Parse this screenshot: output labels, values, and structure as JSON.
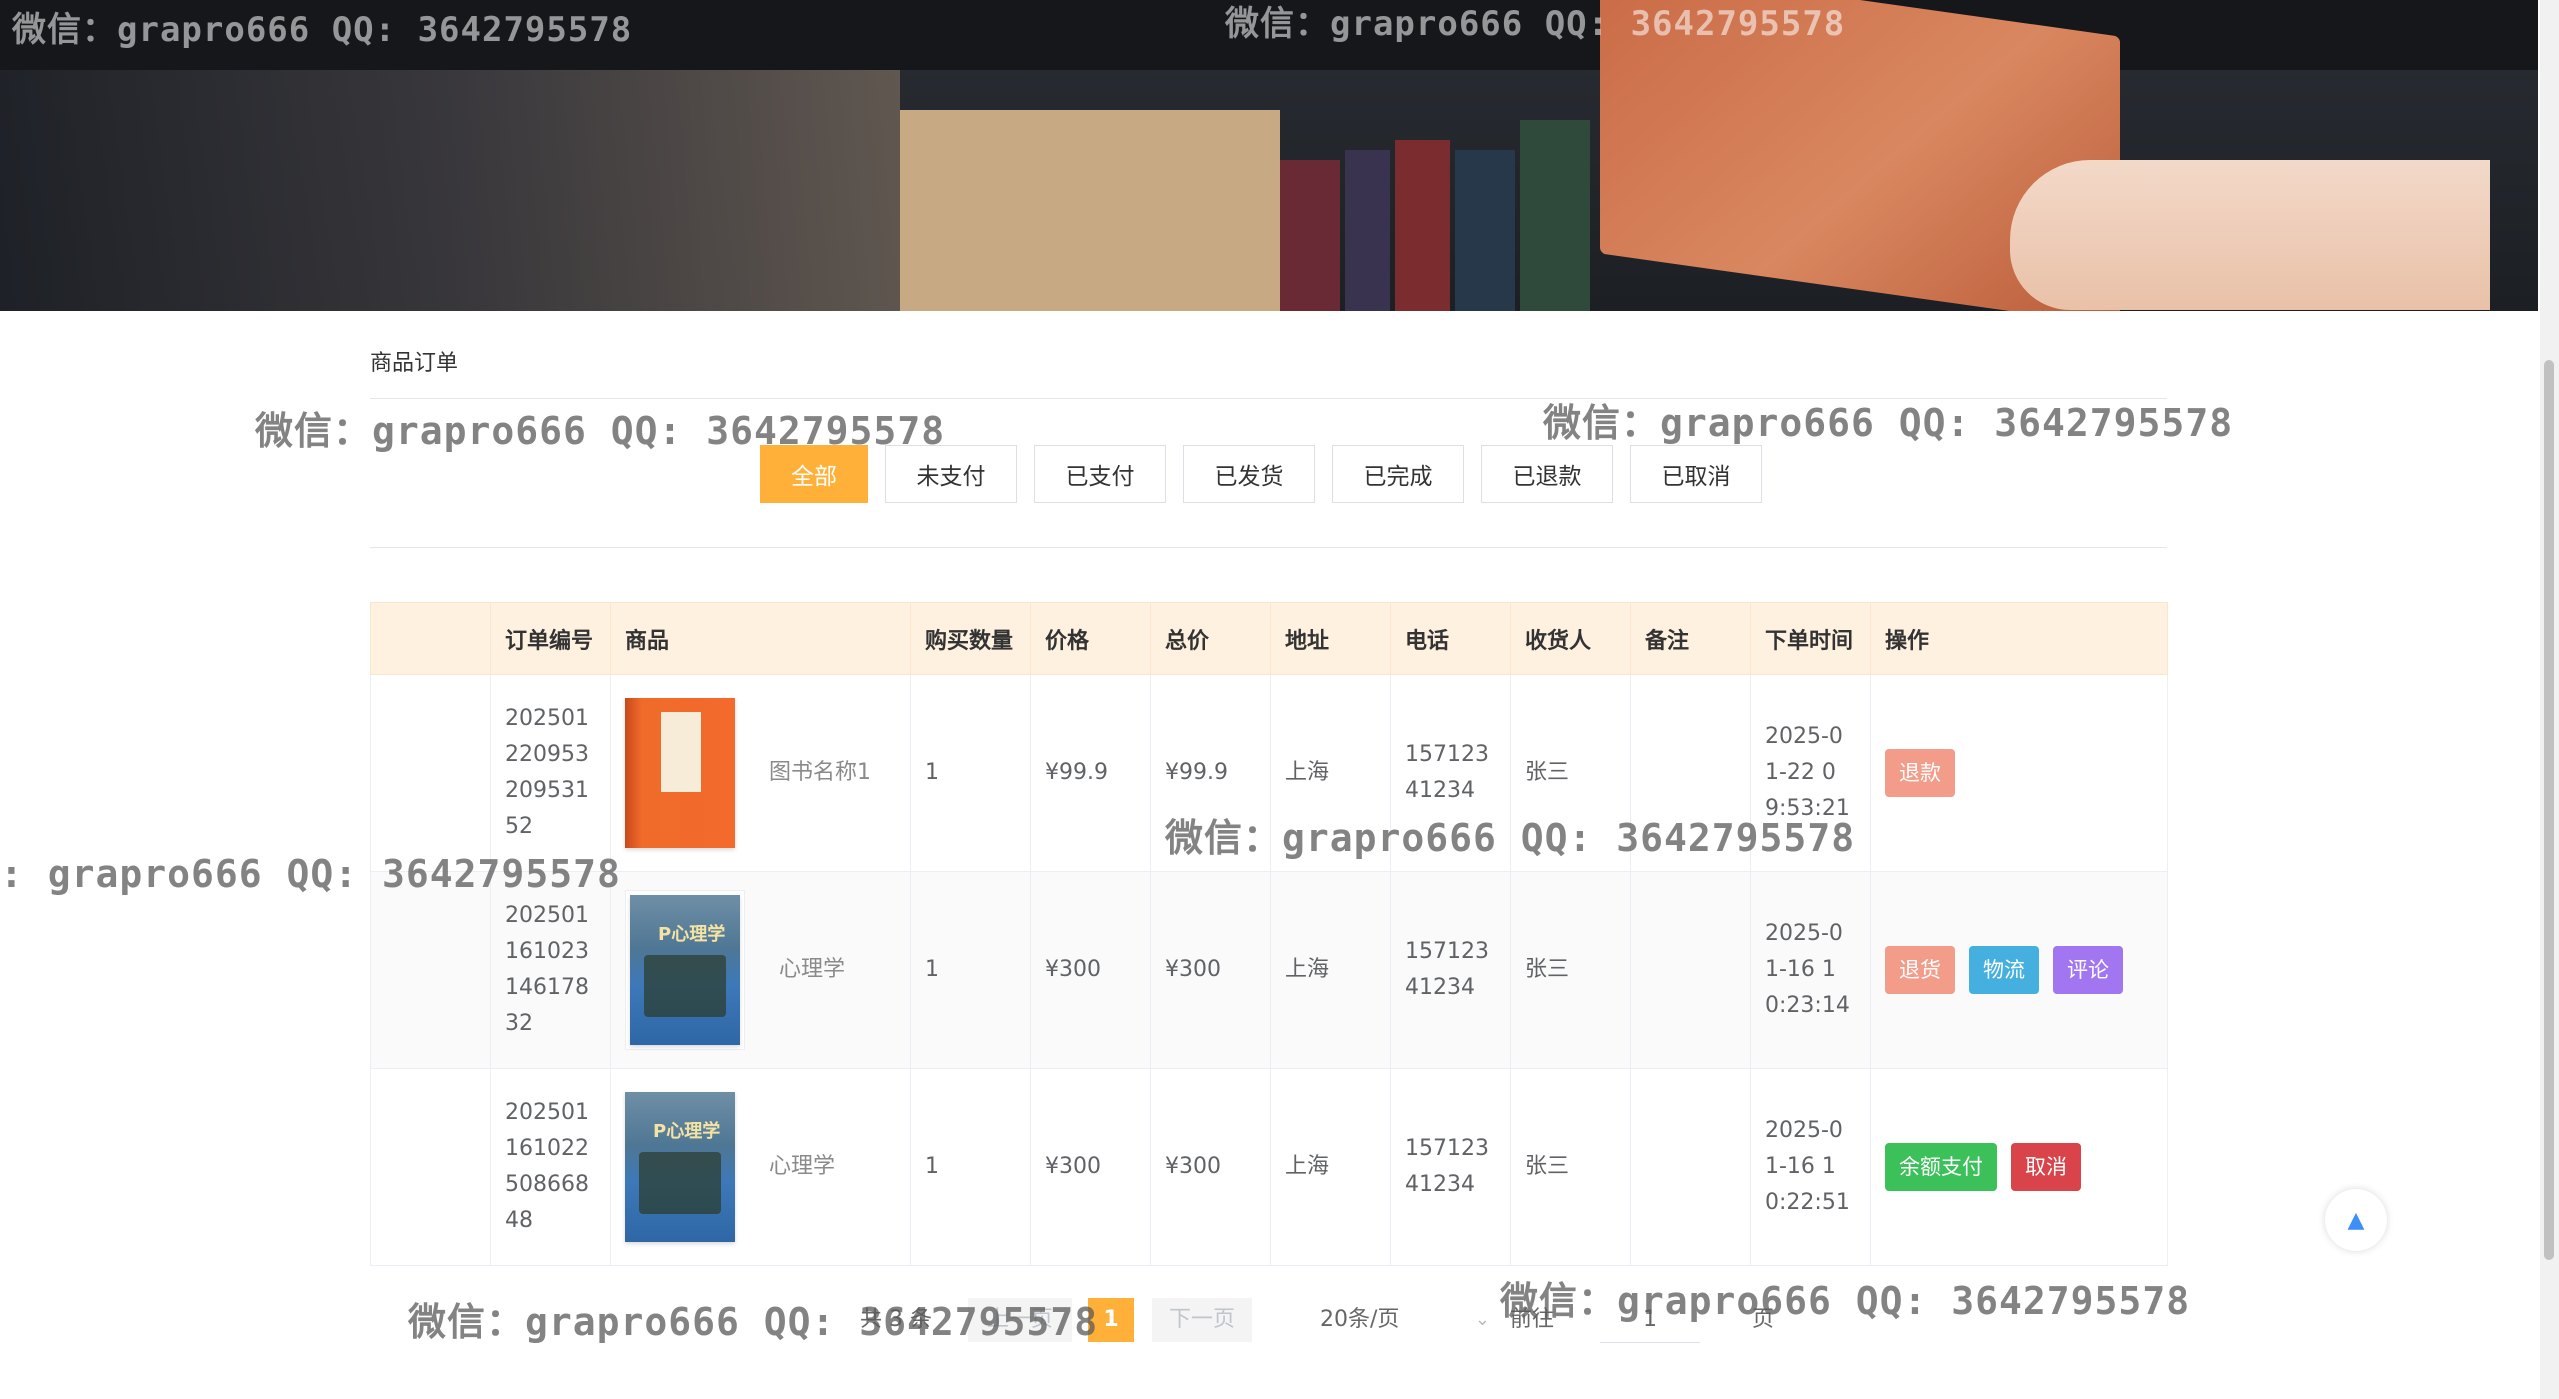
{
  "watermark": "微信：grapro666 QQ: 3642795578",
  "watermark_partial": ": grapro666 QQ: 3642795578",
  "page_title": "商品订单",
  "tabs": [
    {
      "label": "全部",
      "active": true
    },
    {
      "label": "未支付",
      "active": false
    },
    {
      "label": "已支付",
      "active": false
    },
    {
      "label": "已发货",
      "active": false
    },
    {
      "label": "已完成",
      "active": false
    },
    {
      "label": "已退款",
      "active": false
    },
    {
      "label": "已取消",
      "active": false
    }
  ],
  "table": {
    "headers": [
      "订单编号",
      "商品",
      "购买数量",
      "价格",
      "总价",
      "地址",
      "电话",
      "收货人",
      "备注",
      "下单时间",
      "操作"
    ],
    "rows": [
      {
        "order_no": "20250122095320953152",
        "product": "图书名称1",
        "qty": "1",
        "price": "¥99.9",
        "total": "¥99.9",
        "address": "上海",
        "phone": "15712341234",
        "receiver": "张三",
        "remark": "",
        "time": "2025-01-22 09:53:21",
        "cover": "orange-book-cover",
        "actions": [
          "退款"
        ]
      },
      {
        "order_no": "20250116102314617832",
        "product": "心理学",
        "qty": "1",
        "price": "¥300",
        "total": "¥300",
        "address": "上海",
        "phone": "15712341234",
        "receiver": "张三",
        "remark": "",
        "time": "2025-01-16 10:23:14",
        "cover": "psychology-book-cover",
        "actions": [
          "退货",
          "物流",
          "评论"
        ]
      },
      {
        "order_no": "20250116102250866848",
        "product": "心理学",
        "qty": "1",
        "price": "¥300",
        "total": "¥300",
        "address": "上海",
        "phone": "15712341234",
        "receiver": "张三",
        "remark": "",
        "time": "2025-01-16 10:22:51",
        "cover": "psychology-book-cover",
        "actions": [
          "余额支付",
          "取消"
        ]
      }
    ]
  },
  "pagination": {
    "total_text": "共 3 条",
    "prev": "上一页",
    "current": "1",
    "next": "下一页",
    "page_size": "20条/页",
    "goto_label": "前往",
    "goto_value": "1",
    "page_unit": "页"
  },
  "colors": {
    "accent": "#ffb038",
    "header_bg": "#fff1e0"
  }
}
